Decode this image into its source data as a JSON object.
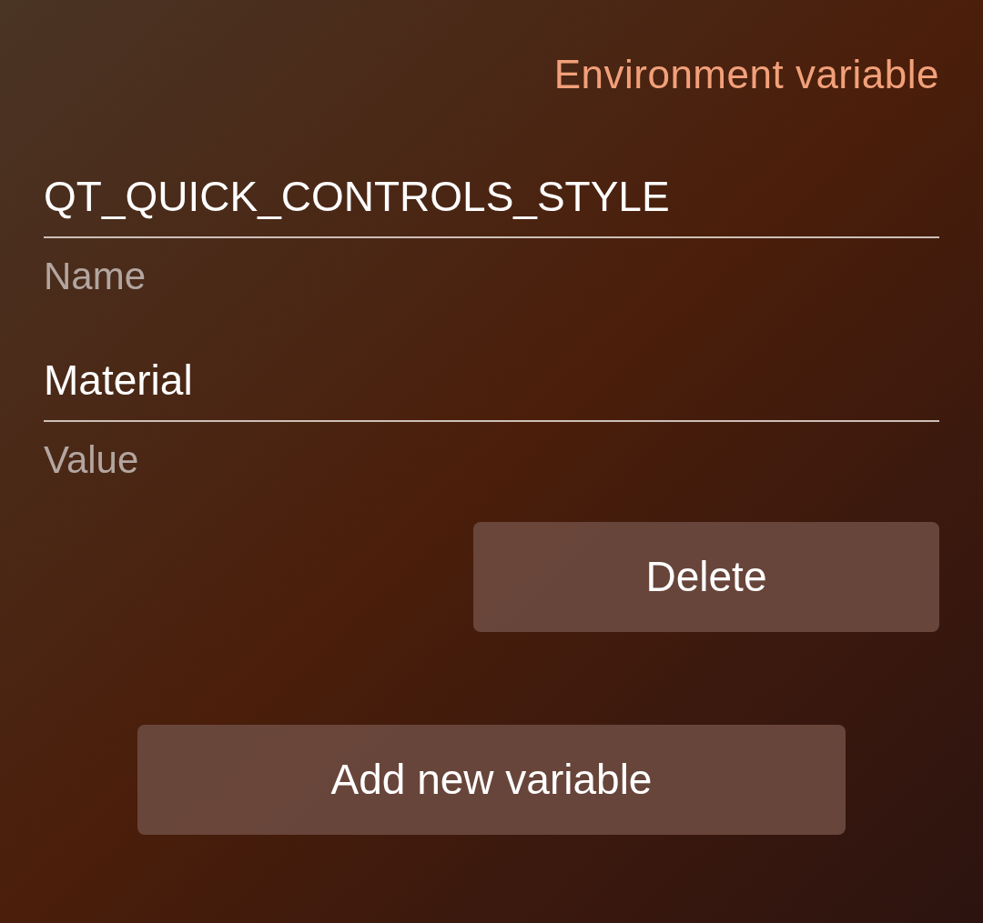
{
  "header": {
    "title": "Environment variable"
  },
  "fields": [
    {
      "label": "Name",
      "value": "QT_QUICK_CONTROLS_STYLE"
    },
    {
      "label": "Value",
      "value": "Material"
    }
  ],
  "delete_button": {
    "label": "Delete"
  },
  "add_button": {
    "label": "Add new variable"
  }
}
